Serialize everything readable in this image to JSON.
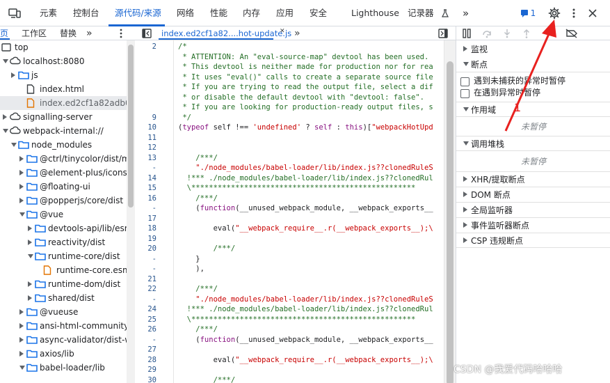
{
  "toolbar": {
    "tabs": [
      "元素",
      "控制台",
      "源代码/来源",
      "网络",
      "性能",
      "内存",
      "应用",
      "安全",
      "Lighthouse",
      "记录器"
    ],
    "active_tab": "源代码/来源",
    "more": "»",
    "issues_count": "1"
  },
  "navigator": {
    "tabs": [
      "页",
      "工作区",
      "替换"
    ],
    "more": "»",
    "tree": [
      {
        "label": "top",
        "icon": "frame-icon",
        "indent": 0,
        "arrow": "down"
      },
      {
        "label": "localhost:8080",
        "icon": "cloud-icon",
        "indent": 1,
        "arrow": "down"
      },
      {
        "label": "js",
        "icon": "folder-icon",
        "indent": 2,
        "arrow": "right"
      },
      {
        "label": "index.html",
        "icon": "file-icon",
        "indent": 3,
        "arrow": ""
      },
      {
        "label": "index.ed2cf1a82adb0a13.",
        "icon": "file-orange-icon",
        "indent": 3,
        "arrow": "",
        "selected": true
      },
      {
        "label": "signalling-server",
        "icon": "cloud-icon",
        "indent": 1,
        "arrow": "right"
      },
      {
        "label": "webpack-internal://",
        "icon": "cloud-icon",
        "indent": 1,
        "arrow": "down"
      },
      {
        "label": "node_modules",
        "icon": "folder-icon",
        "indent": 2,
        "arrow": "down"
      },
      {
        "label": "@ctrl/tinycolor/dist/mc",
        "icon": "folder-icon",
        "indent": 3,
        "arrow": "right"
      },
      {
        "label": "@element-plus/icons-v",
        "icon": "folder-icon",
        "indent": 3,
        "arrow": "right"
      },
      {
        "label": "@floating-ui",
        "icon": "folder-icon",
        "indent": 3,
        "arrow": "right"
      },
      {
        "label": "@popperjs/core/dist",
        "icon": "folder-icon",
        "indent": 3,
        "arrow": "right"
      },
      {
        "label": "@vue",
        "icon": "folder-icon",
        "indent": 3,
        "arrow": "down"
      },
      {
        "label": "devtools-api/lib/esm",
        "icon": "folder-icon",
        "indent": 4,
        "arrow": "right"
      },
      {
        "label": "reactivity/dist",
        "icon": "folder-icon",
        "indent": 4,
        "arrow": "right"
      },
      {
        "label": "runtime-core/dist",
        "icon": "folder-icon",
        "indent": 4,
        "arrow": "down"
      },
      {
        "label": "runtime-core.esm-",
        "icon": "file-orange-icon",
        "indent": 5,
        "arrow": ""
      },
      {
        "label": "runtime-dom/dist",
        "icon": "folder-icon",
        "indent": 4,
        "arrow": "right"
      },
      {
        "label": "shared/dist",
        "icon": "folder-icon",
        "indent": 4,
        "arrow": "right"
      },
      {
        "label": "@vueuse",
        "icon": "folder-icon",
        "indent": 3,
        "arrow": "right"
      },
      {
        "label": "ansi-html-community",
        "icon": "folder-icon",
        "indent": 3,
        "arrow": "right"
      },
      {
        "label": "async-validator/dist-we",
        "icon": "folder-icon",
        "indent": 3,
        "arrow": "right"
      },
      {
        "label": "axios/lib",
        "icon": "folder-icon",
        "indent": 3,
        "arrow": "right"
      },
      {
        "label": "babel-loader/lib",
        "icon": "folder-icon",
        "indent": 3,
        "arrow": "down"
      }
    ]
  },
  "editor": {
    "tab_label": "index.ed2cf1a82....hot-update.js",
    "more": "»",
    "lines": [
      {
        "n": "2",
        "text": "/*",
        "cls": "cm"
      },
      {
        "n": "",
        "text": " * ATTENTION: An \"eval-source-map\" devtool has been used.",
        "cls": "cm"
      },
      {
        "n": "",
        "text": " * This devtool is neither made for production nor for rea",
        "cls": "cm"
      },
      {
        "n": "",
        "text": " * It uses \"eval()\" calls to create a separate source file",
        "cls": "cm"
      },
      {
        "n": "",
        "text": " * If you are trying to read the output file, select a dif",
        "cls": "cm"
      },
      {
        "n": "",
        "text": " * or disable the default devtool with \"devtool: false\".",
        "cls": "cm"
      },
      {
        "n": "",
        "text": " * If you are looking for production-ready output files, s",
        "cls": "cm"
      },
      {
        "n": "9",
        "text": " */",
        "cls": "cm"
      },
      {
        "n": "10",
        "text": "(typeof self !== 'undefined' ? self : this)[\"webpackHotUpd",
        "cls": "mix"
      },
      {
        "n": "11",
        "text": "",
        "cls": ""
      },
      {
        "n": "12",
        "text": "",
        "cls": ""
      },
      {
        "n": "13",
        "text": "    /***/",
        "cls": "cm"
      },
      {
        "n": "-",
        "text": "    \"./node_modules/babel-loader/lib/index.js??clonedRuleS",
        "cls": "st"
      },
      {
        "n": "14",
        "text": "  !*** ./node_modules/babel-loader/lib/index.js??clonedRul",
        "cls": "cm"
      },
      {
        "n": "15",
        "text": "  \\***************************************************",
        "cls": "cm"
      },
      {
        "n": "16",
        "text": "    /***/",
        "cls": "cm"
      },
      {
        "n": "-",
        "text": "    (function(__unused_webpack_module, __webpack_exports__",
        "cls": "fn"
      },
      {
        "n": "17",
        "text": "",
        "cls": ""
      },
      {
        "n": "18",
        "text": "        eval(\"__webpack_require__.r(__webpack_exports__);\\",
        "cls": "ev"
      },
      {
        "n": "19",
        "text": "",
        "cls": ""
      },
      {
        "n": "20",
        "text": "        /***/",
        "cls": "cm"
      },
      {
        "n": "-",
        "text": "    }",
        "cls": ""
      },
      {
        "n": "-",
        "text": "    ),",
        "cls": ""
      },
      {
        "n": "21",
        "text": "",
        "cls": ""
      },
      {
        "n": "22",
        "text": "    /***/",
        "cls": "cm"
      },
      {
        "n": "-",
        "text": "    \"./node_modules/babel-loader/lib/index.js??clonedRuleS",
        "cls": "st"
      },
      {
        "n": "24",
        "text": "  !*** ./node_modules/babel-loader/lib/index.js??clonedRul",
        "cls": "cm"
      },
      {
        "n": "25",
        "text": "  \\***************************************************",
        "cls": "cm"
      },
      {
        "n": "26",
        "text": "    /***/",
        "cls": "cm"
      },
      {
        "n": "-",
        "text": "    (function(__unused_webpack_module, __webpack_exports__",
        "cls": "fn"
      },
      {
        "n": "27",
        "text": "",
        "cls": ""
      },
      {
        "n": "28",
        "text": "        eval(\"__webpack_require__.r(__webpack_exports__);\\",
        "cls": "ev"
      },
      {
        "n": "29",
        "text": "",
        "cls": ""
      },
      {
        "n": "30",
        "text": "        /***/",
        "cls": "cm"
      },
      {
        "n": "-",
        "text": "    }",
        "cls": ""
      }
    ]
  },
  "debugger": {
    "sections": {
      "watch": "监视",
      "breakpoints": "断点",
      "pause_uncaught": "遇到未捕获的异常时暂停",
      "pause_caught": "在遇到异常时暂停",
      "scope": "作用域",
      "not_paused_1": "未暂停",
      "call_stack": "调用堆栈",
      "not_paused_2": "未暂停",
      "xhr": "XHR/提取断点",
      "dom": "DOM 断点",
      "global": "全局监听器",
      "event": "事件监听器断点",
      "csp": "CSP 违规断点"
    }
  },
  "annotation": {
    "number": "1",
    "color": "#e8211f"
  },
  "watermark": "CSDN @我爱代码哈哈哈",
  "colors": {
    "accent": "#1a66d2",
    "folder": "#1a73e8",
    "orange_file": "#e37400",
    "comment": "#236e25",
    "string": "#c80000",
    "keyword": "#881280"
  }
}
